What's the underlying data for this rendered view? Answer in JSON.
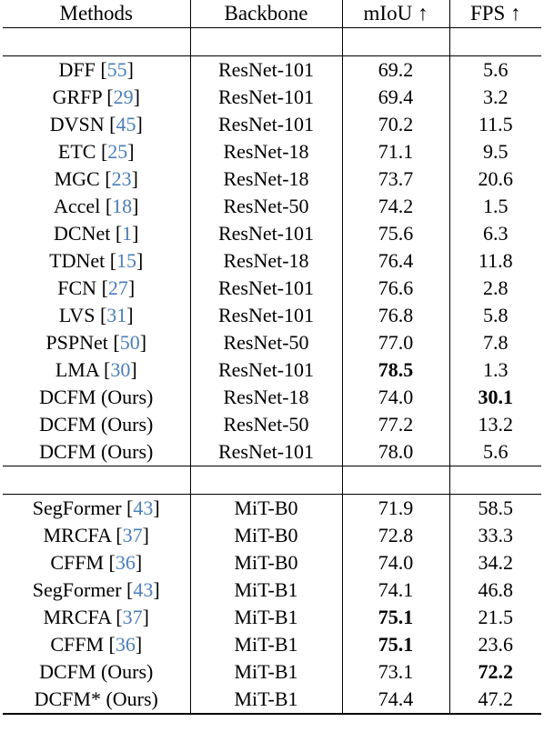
{
  "table": {
    "columns": [
      {
        "key": "method",
        "label": "Methods"
      },
      {
        "key": "backbone",
        "label": "Backbone"
      },
      {
        "key": "miou",
        "label": "mIoU ↑"
      },
      {
        "key": "fps",
        "label": "FPS ↑"
      }
    ],
    "citation_color": "#4a7ebb",
    "sections": [
      {
        "name": "cnn-backbones",
        "rows": [
          {
            "method": "DFF",
            "cite": "55",
            "backbone": "ResNet-101",
            "miou": "69.2",
            "fps": "5.6",
            "miou_bold": false,
            "fps_bold": false
          },
          {
            "method": "GRFP",
            "cite": "29",
            "backbone": "ResNet-101",
            "miou": "69.4",
            "fps": "3.2",
            "miou_bold": false,
            "fps_bold": false
          },
          {
            "method": "DVSN",
            "cite": "45",
            "backbone": "ResNet-101",
            "miou": "70.2",
            "fps": "11.5",
            "miou_bold": false,
            "fps_bold": false
          },
          {
            "method": "ETC",
            "cite": "25",
            "backbone": "ResNet-18",
            "miou": "71.1",
            "fps": "9.5",
            "miou_bold": false,
            "fps_bold": false
          },
          {
            "method": "MGC",
            "cite": "23",
            "backbone": "ResNet-18",
            "miou": "73.7",
            "fps": "20.6",
            "miou_bold": false,
            "fps_bold": false
          },
          {
            "method": "Accel",
            "cite": "18",
            "backbone": "ResNet-50",
            "miou": "74.2",
            "fps": "1.5",
            "miou_bold": false,
            "fps_bold": false
          },
          {
            "method": "DCNet",
            "cite": "1",
            "backbone": "ResNet-101",
            "miou": "75.6",
            "fps": "6.3",
            "miou_bold": false,
            "fps_bold": false
          },
          {
            "method": "TDNet",
            "cite": "15",
            "backbone": "ResNet-18",
            "miou": "76.4",
            "fps": "11.8",
            "miou_bold": false,
            "fps_bold": false
          },
          {
            "method": "FCN",
            "cite": "27",
            "backbone": "ResNet-101",
            "miou": "76.6",
            "fps": "2.8",
            "miou_bold": false,
            "fps_bold": false
          },
          {
            "method": "LVS",
            "cite": "31",
            "backbone": "ResNet-101",
            "miou": "76.8",
            "fps": "5.8",
            "miou_bold": false,
            "fps_bold": false
          },
          {
            "method": "PSPNet",
            "cite": "50",
            "backbone": "ResNet-50",
            "miou": "77.0",
            "fps": "7.8",
            "miou_bold": false,
            "fps_bold": false
          },
          {
            "method": "LMA",
            "cite": "30",
            "backbone": "ResNet-101",
            "miou": "78.5",
            "fps": "1.3",
            "miou_bold": true,
            "fps_bold": false
          },
          {
            "method": "DCFM (Ours)",
            "cite": null,
            "backbone": "ResNet-18",
            "miou": "74.0",
            "fps": "30.1",
            "miou_bold": false,
            "fps_bold": true
          },
          {
            "method": "DCFM (Ours)",
            "cite": null,
            "backbone": "ResNet-50",
            "miou": "77.2",
            "fps": "13.2",
            "miou_bold": false,
            "fps_bold": false
          },
          {
            "method": "DCFM (Ours)",
            "cite": null,
            "backbone": "ResNet-101",
            "miou": "78.0",
            "fps": "5.6",
            "miou_bold": false,
            "fps_bold": false
          }
        ]
      },
      {
        "name": "transformer-backbones",
        "rows": [
          {
            "method": "SegFormer",
            "cite": "43",
            "backbone": "MiT-B0",
            "miou": "71.9",
            "fps": "58.5",
            "miou_bold": false,
            "fps_bold": false
          },
          {
            "method": "MRCFA",
            "cite": "37",
            "backbone": "MiT-B0",
            "miou": "72.8",
            "fps": "33.3",
            "miou_bold": false,
            "fps_bold": false
          },
          {
            "method": "CFFM",
            "cite": "36",
            "backbone": "MiT-B0",
            "miou": "74.0",
            "fps": "34.2",
            "miou_bold": false,
            "fps_bold": false
          },
          {
            "method": "SegFormer",
            "cite": "43",
            "backbone": "MiT-B1",
            "miou": "74.1",
            "fps": "46.8",
            "miou_bold": false,
            "fps_bold": false
          },
          {
            "method": "MRCFA",
            "cite": "37",
            "backbone": "MiT-B1",
            "miou": "75.1",
            "fps": "21.5",
            "miou_bold": true,
            "fps_bold": false
          },
          {
            "method": "CFFM",
            "cite": "36",
            "backbone": "MiT-B1",
            "miou": "75.1",
            "fps": "23.6",
            "miou_bold": true,
            "fps_bold": false
          },
          {
            "method": "DCFM (Ours)",
            "cite": null,
            "backbone": "MiT-B1",
            "miou": "73.1",
            "fps": "72.2",
            "miou_bold": false,
            "fps_bold": true
          },
          {
            "method": "DCFM* (Ours)",
            "cite": null,
            "backbone": "MiT-B1",
            "miou": "74.4",
            "fps": "47.2",
            "miou_bold": false,
            "fps_bold": false
          }
        ]
      }
    ]
  }
}
